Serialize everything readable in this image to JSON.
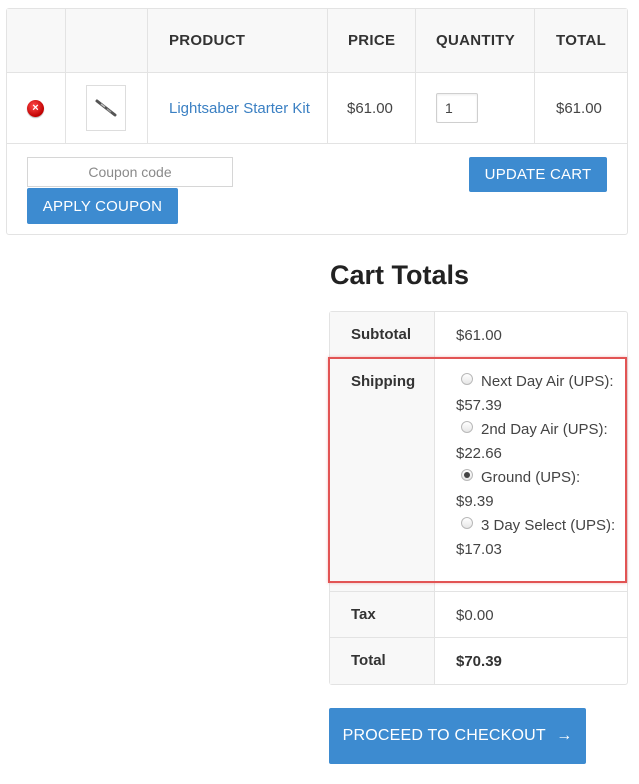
{
  "cart": {
    "headers": {
      "product": "PRODUCT",
      "price": "PRICE",
      "quantity": "QUANTITY",
      "total": "TOTAL"
    },
    "item": {
      "remove_icon": "remove-icon",
      "remove_glyph": "×",
      "name": "Lightsaber Starter Kit",
      "price": "$61.00",
      "quantity": "1",
      "total": "$61.00"
    },
    "coupon": {
      "placeholder": "Coupon code",
      "apply_label": "APPLY COUPON"
    },
    "update_label": "UPDATE CART"
  },
  "totals": {
    "title": "Cart Totals",
    "subtotal_label": "Subtotal",
    "subtotal_value": "$61.00",
    "shipping_label": "Shipping",
    "shipping_options": [
      {
        "label": "Next Day Air (UPS): $57.39",
        "checked": false
      },
      {
        "label": "2nd Day Air (UPS): $22.66",
        "checked": false
      },
      {
        "label": "Ground (UPS): $9.39",
        "checked": true
      },
      {
        "label": "3 Day Select (UPS): $17.03",
        "checked": false
      }
    ],
    "tax_label": "Tax",
    "tax_value": "$0.00",
    "total_label": "Total",
    "total_value": "$70.39"
  },
  "checkout": {
    "label": "PROCEED TO CHECKOUT",
    "arrow": "→"
  },
  "colors": {
    "accent": "#3d8bd0",
    "link": "#3b80c3",
    "highlight": "#e25454",
    "remove": "#d11a1a"
  }
}
